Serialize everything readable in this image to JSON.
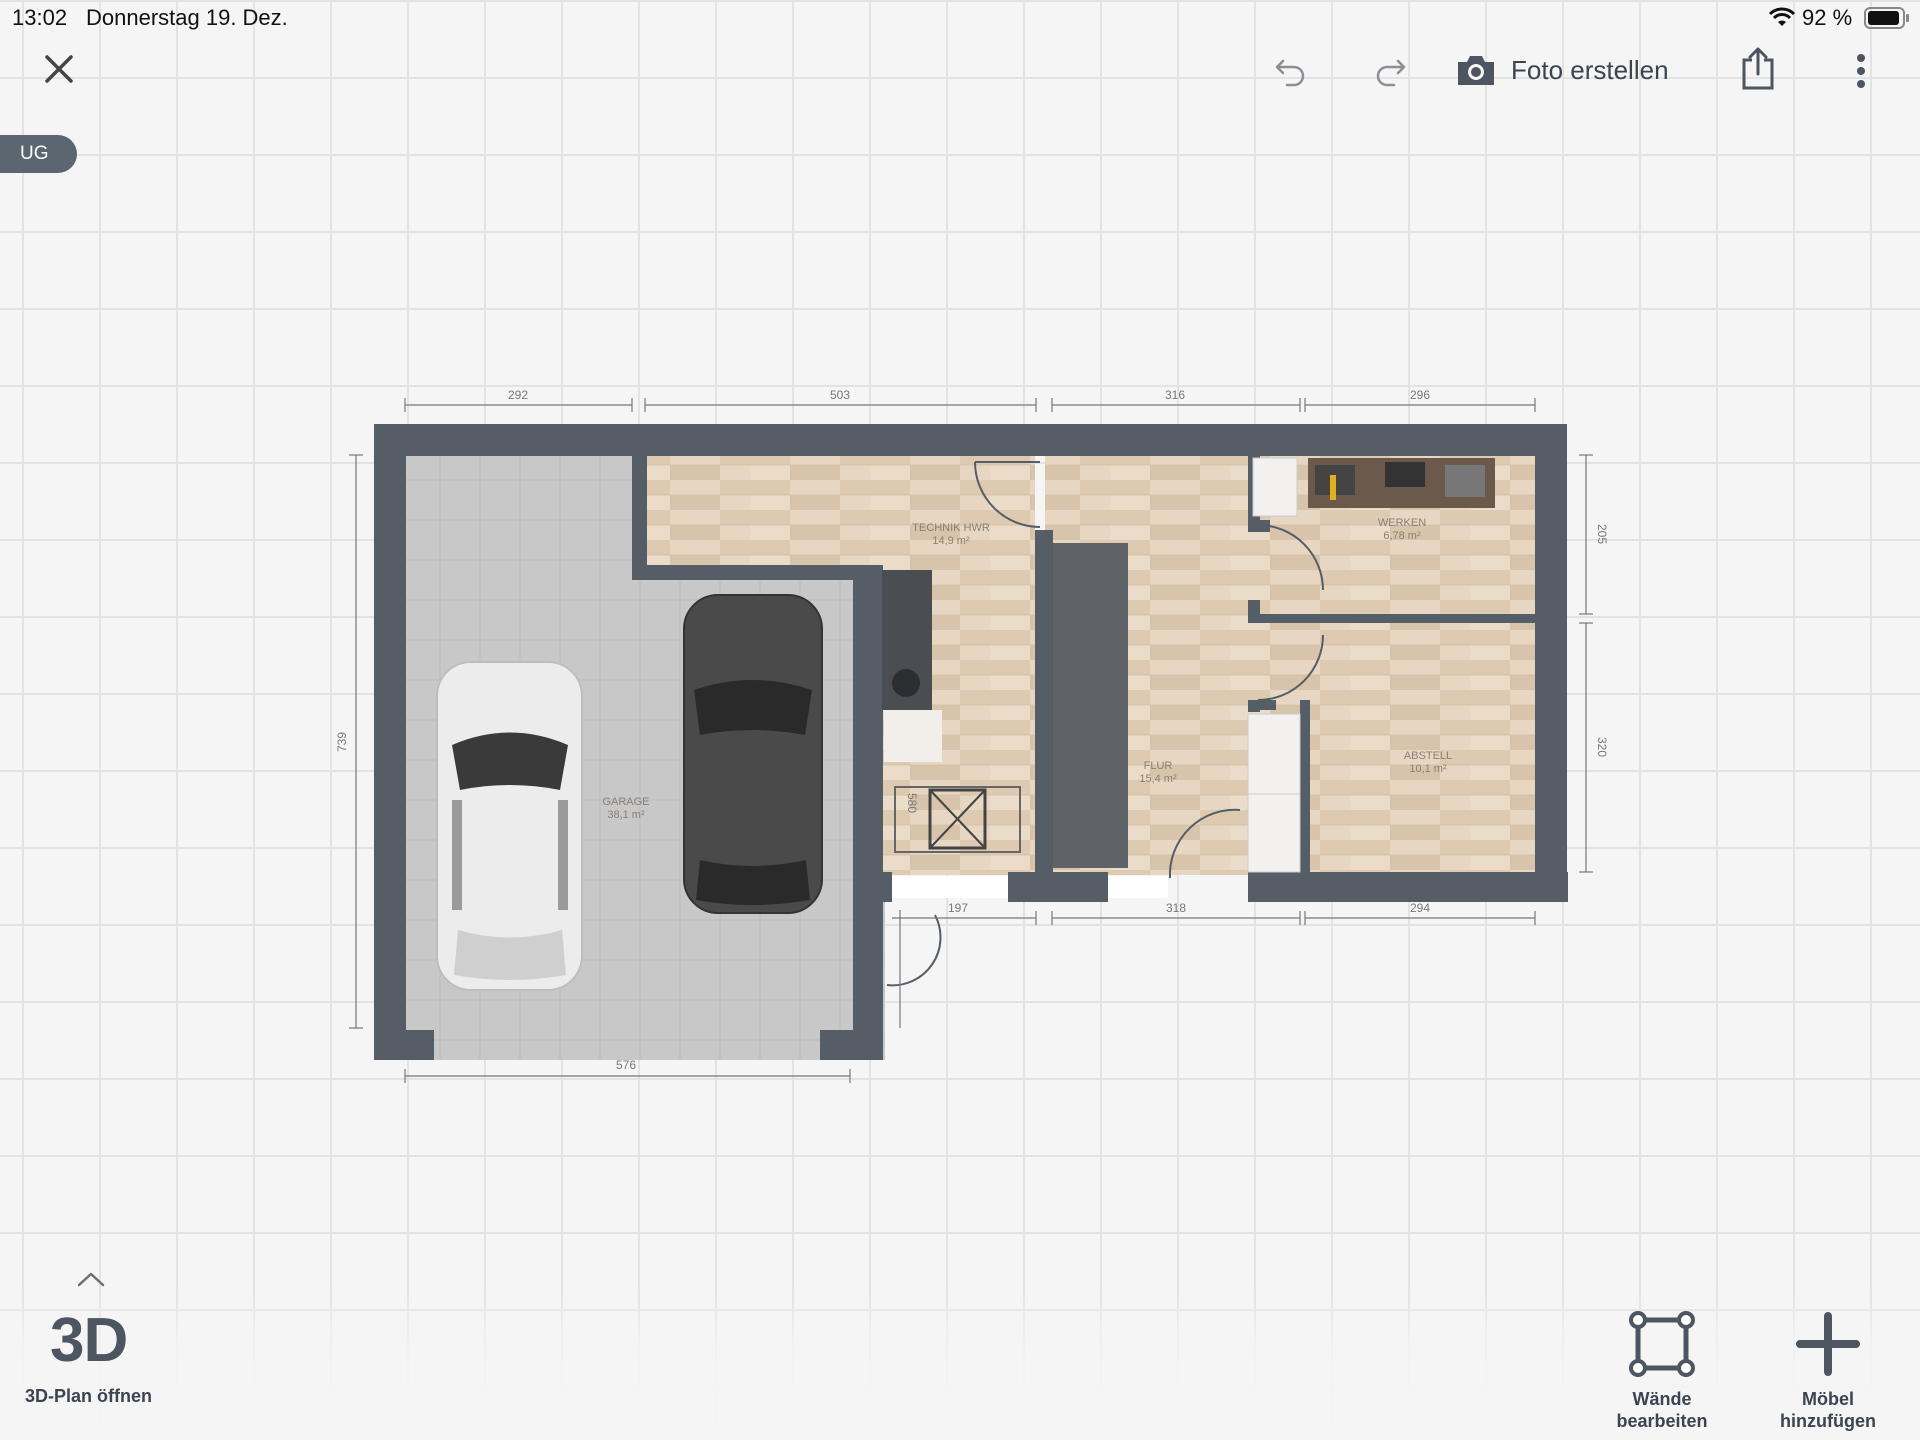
{
  "status_bar": {
    "time": "13:02",
    "date": "Donnerstag 19. Dez.",
    "battery": "92 %"
  },
  "toolbar": {
    "photo_label": "Foto erstellen"
  },
  "floor": {
    "label": "UG"
  },
  "rooms": [
    {
      "name": "GARAGE",
      "area": "38,1 m²"
    },
    {
      "name": "TECHNIK HWR",
      "area": "14,9 m²"
    },
    {
      "name": "FLUR",
      "area": "15,4 m²"
    },
    {
      "name": "WERKEN",
      "area": "6,78 m²"
    },
    {
      "name": "ABSTELL",
      "area": "10,1 m²"
    }
  ],
  "dimensions": {
    "top": [
      "292",
      "503",
      "316",
      "296"
    ],
    "right": [
      "205",
      "320"
    ],
    "left": "739",
    "bottom_garage": "576",
    "bottom": [
      "197",
      "318",
      "294"
    ],
    "stair": "580"
  },
  "bottom_bar": {
    "three_d": "3D",
    "three_d_label": "3D-Plan öffnen",
    "walls_label": "Wände bearbeiten",
    "furniture_label": "Möbel hinzufügen"
  },
  "colors": {
    "wall": "#555d66",
    "floor_wood": "#e4d3bd",
    "garage_floor": "#c9c9c9",
    "accent": "#4c5560"
  }
}
